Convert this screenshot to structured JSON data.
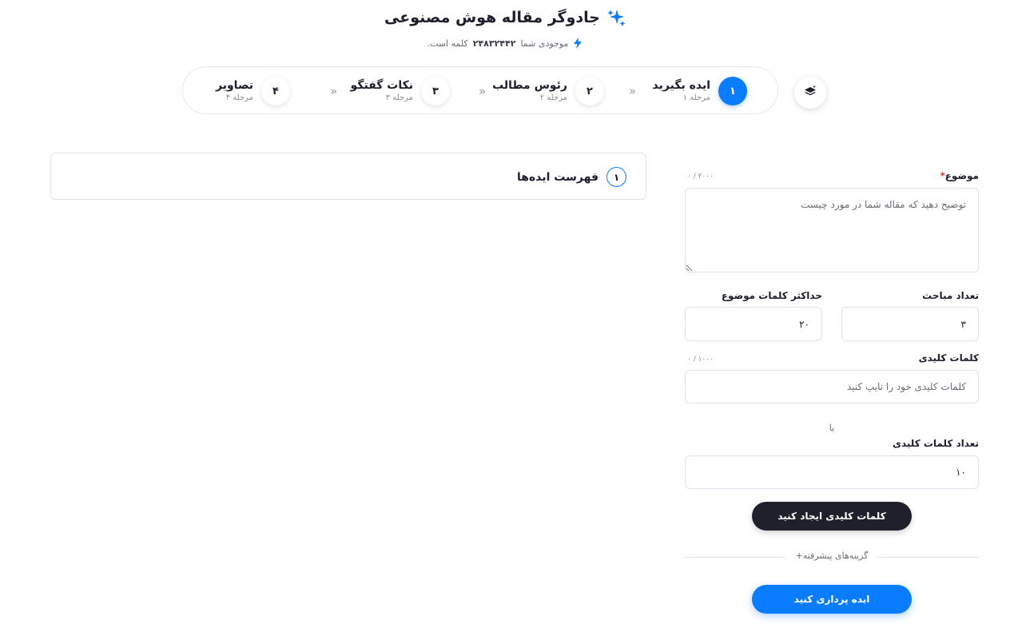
{
  "header": {
    "title": "جادوگر مقاله هوش مصنوعی",
    "balance_prefix": "موجودی شما",
    "balance_value": "۲۴۸۳۲۴۴۲",
    "balance_suffix": "کلمه است.",
    "accent_color": "#0a7cff"
  },
  "stepper": {
    "steps": [
      {
        "number": "۱",
        "title": "ایده بگیرید",
        "subtitle": "مرحله ۱",
        "active": true
      },
      {
        "number": "۲",
        "title": "رئوس مطالب",
        "subtitle": "مرحله ۲",
        "active": false
      },
      {
        "number": "۳",
        "title": "نکات گفتگو",
        "subtitle": "مرحله ۳",
        "active": false
      },
      {
        "number": "۴",
        "title": "تصاویر",
        "subtitle": "مرحله ۴",
        "active": false
      }
    ],
    "separator": "»",
    "layers_icon": "layers-icon"
  },
  "ideas": {
    "number": "۱",
    "title": "فهرست ایده‌ها"
  },
  "form": {
    "topic": {
      "label": "موضوع",
      "required_mark": "*",
      "counter": "۰ / ۲۰۰۰",
      "placeholder": "توضیح دهید که مقاله شما در مورد چیست",
      "value": ""
    },
    "sections": {
      "label": "تعداد مباحث",
      "value": "۳"
    },
    "max_words": {
      "label": "حداکثر کلمات موضوع",
      "value": "۲۰"
    },
    "keywords": {
      "label": "کلمات کلیدی",
      "counter": "۰ / ۱۰۰۰",
      "placeholder": "کلمات کلیدی خود را تایپ کنید",
      "value": ""
    },
    "or_text": "یا",
    "keyword_count": {
      "label": "تعداد کلمات کلیدی",
      "value": "۱۰"
    },
    "generate_keywords_button": "کلمات کلیدی ایجاد کنید",
    "advanced_options": "گزینه‌های پیشرفته+",
    "submit_button": "ایده پردازی کنید"
  }
}
